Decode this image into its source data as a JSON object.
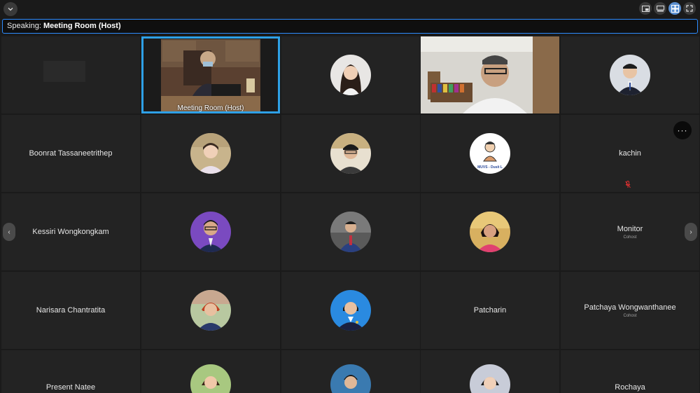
{
  "topbar": {
    "collapse_icon": "chevron-down-icon",
    "view_icons": [
      "picture-in-picture-icon",
      "speaker-view-icon",
      "gallery-view-icon",
      "fullscreen-icon"
    ]
  },
  "speaking": {
    "prefix": "Speaking:",
    "name": "Meeting Room (Host)"
  },
  "participants": {
    "p01": {
      "name": "",
      "role": ""
    },
    "p02": {
      "name": "Meeting Room  (Host)",
      "role": ""
    },
    "p03": {
      "name": "",
      "role": ""
    },
    "p04": {
      "name": "",
      "role": ""
    },
    "p05": {
      "name": "",
      "role": ""
    },
    "p06": {
      "name": "Boonrat Tassaneetrithep",
      "role": ""
    },
    "p07": {
      "name": "",
      "role": ""
    },
    "p08": {
      "name": "",
      "role": ""
    },
    "p09": {
      "name": "",
      "role": "",
      "avatar_text": "MUVS - Dusit L"
    },
    "p10": {
      "name": "kachin",
      "role": ""
    },
    "p11": {
      "name": "Kessiri Wongkongkam",
      "role": ""
    },
    "p12": {
      "name": "",
      "role": ""
    },
    "p13": {
      "name": "",
      "role": ""
    },
    "p14": {
      "name": "",
      "role": ""
    },
    "p15": {
      "name": "Monitor",
      "role": "Cohost"
    },
    "p16": {
      "name": "Narisara Chantratita",
      "role": ""
    },
    "p17": {
      "name": "",
      "role": ""
    },
    "p18": {
      "name": "",
      "role": ""
    },
    "p19": {
      "name": "Patcharin",
      "role": ""
    },
    "p20": {
      "name": "Patchaya Wongwanthanee",
      "role": "Cohost"
    },
    "p21": {
      "name": "Present Natee",
      "role": ""
    },
    "p22": {
      "name": "",
      "role": ""
    },
    "p23": {
      "name": "",
      "role": ""
    },
    "p24": {
      "name": "",
      "role": ""
    },
    "p25": {
      "name": "Rochaya",
      "role": ""
    }
  },
  "nav": {
    "prev": "‹",
    "next": "›",
    "more": "···"
  },
  "colors": {
    "accent": "#2d8cff",
    "active_speaker": "#2ea0e6",
    "tile_bg": "#232323",
    "app_bg": "#1a1a1a"
  }
}
